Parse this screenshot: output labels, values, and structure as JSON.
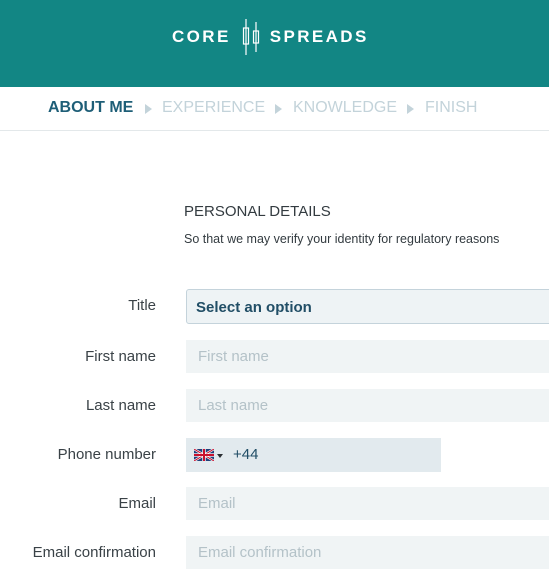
{
  "brand": {
    "left": "CORE",
    "right": "SPREADS"
  },
  "steps": [
    {
      "label": "ABOUT ME",
      "active": true
    },
    {
      "label": "EXPERIENCE",
      "active": false
    },
    {
      "label": "KNOWLEDGE",
      "active": false
    },
    {
      "label": "FINISH",
      "active": false
    }
  ],
  "section": {
    "title": "PERSONAL DETAILS",
    "subtitle": "So that we may verify your identity for regulatory reasons"
  },
  "form": {
    "title": {
      "label": "Title",
      "selected": "Select an option"
    },
    "first_name": {
      "label": "First name",
      "placeholder": "First name"
    },
    "last_name": {
      "label": "Last name",
      "placeholder": "Last name"
    },
    "phone": {
      "label": "Phone number",
      "dial_code": "+44",
      "country_icon": "uk-flag-icon"
    },
    "email": {
      "label": "Email",
      "placeholder": "Email"
    },
    "email_confirm": {
      "label": "Email confirmation",
      "placeholder": "Email confirmation"
    }
  },
  "colors": {
    "header_bg": "#128684",
    "active_step": "#1e5e77",
    "inactive_step": "#c3d3da",
    "field_bg": "#f0f4f5"
  }
}
